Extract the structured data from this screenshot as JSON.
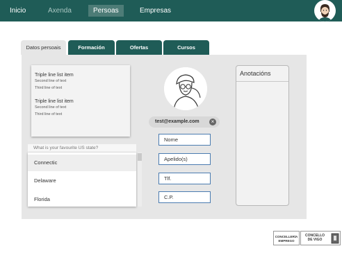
{
  "nav": {
    "items": [
      {
        "label": "Inicio"
      },
      {
        "label": "Axenda"
      },
      {
        "label": "Persoas"
      },
      {
        "label": "Empresas"
      }
    ]
  },
  "tabs": [
    {
      "label": "Datos persoais"
    },
    {
      "label": "Formación"
    },
    {
      "label": "Ofertas"
    },
    {
      "label": "Cursos"
    }
  ],
  "list": {
    "items": [
      {
        "primary": "Triple line list item",
        "secondary": "Second line of text",
        "tertiary": "Third line of text"
      },
      {
        "primary": "Triple line list item",
        "secondary": "Second line of text",
        "tertiary": "Third line of text"
      }
    ]
  },
  "state_search": {
    "placeholder": "What is your favourite US state?",
    "options": [
      "Connectic",
      "Delaware",
      "Florida"
    ]
  },
  "email_chip": {
    "label": "test@example.com"
  },
  "form": {
    "nome": "Nome",
    "apelidos": "Apelido(s)",
    "tlf": "Tlf.",
    "cp": "C.P."
  },
  "notes": {
    "title": "Anotacións"
  },
  "footer": {
    "logo_left": {
      "line1": "CONCELLERÍA",
      "line2": "EMPREGO"
    },
    "logo_right": {
      "line1": "CONCELLO",
      "line2": "DE VIGO"
    }
  },
  "colors": {
    "brand": "#1f5c57",
    "panel": "#e6e6e6",
    "field_border": "#4a7bb0"
  }
}
